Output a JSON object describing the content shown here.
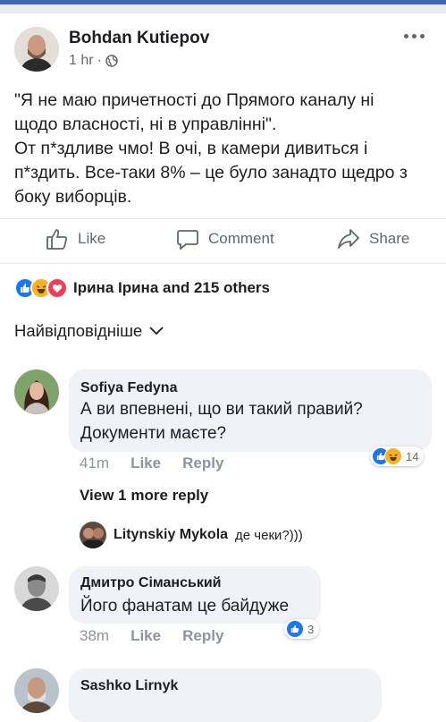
{
  "post": {
    "author": "Bohdan Kutiepov",
    "time": "1 hr",
    "separator": "·",
    "privacy_icon": "globe-icon",
    "text_line1": "\"Я не маю причетності до Прямого каналу ні",
    "text_line2": "щодо власності, ні в управлінні\".",
    "text_line3": "От п*здливе чмо! В очі, в камери дивиться і",
    "text_line4": "п*здить. Все-таки 8% – це було занадто щедро з",
    "text_line5": "боку виборців."
  },
  "actions": {
    "like": "Like",
    "comment": "Comment",
    "share": "Share"
  },
  "reactions": {
    "icons": [
      "like-icon",
      "haha-icon",
      "love-icon"
    ],
    "text": "Ірина Ірина and 215 others"
  },
  "sort": {
    "label": "Найвідповідніше",
    "icon": "chevron-down-icon"
  },
  "comments": [
    {
      "name": "Sofiya Fedyna",
      "text_line1": "А ви впевнені, що ви такий правий?",
      "text_line2": "Документи маєте?",
      "time": "41m",
      "like": "Like",
      "reply": "Reply",
      "reaction_count": "14",
      "reaction_icons": [
        "like-icon",
        "haha-icon"
      ],
      "view_more": "View 1 more reply",
      "reply_preview": {
        "name": "Litynskiy Mykola",
        "text": "де чеки?)))"
      }
    },
    {
      "name": "Дмитро Сіманський",
      "text_line1": "Його фанатам це байдуже",
      "time": "38m",
      "like": "Like",
      "reply": "Reply",
      "reaction_count": "3",
      "reaction_icons": [
        "like-icon"
      ]
    },
    {
      "name": "Sashko Lirnyk"
    }
  ],
  "colors": {
    "brand": "#4267b2",
    "like_blue": "#1877f2",
    "love_red": "#f33e58",
    "haha_yellow": "#f7b125",
    "muted_text": "#65676b",
    "bubble_bg": "#f0f2f5"
  }
}
